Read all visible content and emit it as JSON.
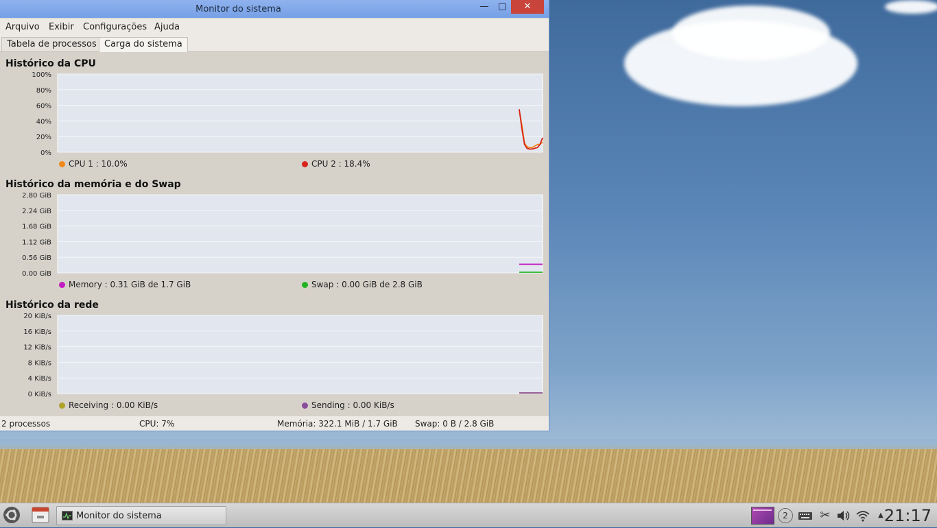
{
  "window": {
    "title": "Monitor do sistema",
    "controls": {
      "minimize": "—",
      "maximize": "□",
      "close": "✕"
    }
  },
  "menu": [
    "Arquivo",
    "Exibir",
    "Configurações",
    "Ajuda"
  ],
  "tabs": [
    {
      "label": "Tabela de processos",
      "active": false
    },
    {
      "label": "Carga do sistema",
      "active": true
    }
  ],
  "cpu": {
    "title": "Histórico da CPU",
    "ticks": [
      "100%",
      "80%",
      "60%",
      "40%",
      "20%",
      "0%"
    ],
    "legend": [
      {
        "label": "CPU 1 : 10.0%",
        "color": "#f08a1c"
      },
      {
        "label": "CPU 2 : 18.4%",
        "color": "#d8241a"
      }
    ]
  },
  "memory": {
    "title": "Histórico da memória e do Swap",
    "ticks": [
      "2.80 GiB",
      "2.24 GiB",
      "1.68 GiB",
      "1.12 GiB",
      "0.56 GiB",
      "0.00 GiB"
    ],
    "legend": [
      {
        "label": "Memory : 0.31 GiB de 1.7 GiB",
        "color": "#c21dc0"
      },
      {
        "label": "Swap : 0.00 GiB de 2.8 GiB",
        "color": "#22b322"
      }
    ]
  },
  "network": {
    "title": "Histórico da rede",
    "ticks": [
      "20 KiB/s",
      "16 KiB/s",
      "12 KiB/s",
      "8 KiB/s",
      "4 KiB/s",
      "0 KiB/s"
    ],
    "legend": [
      {
        "label": "Receiving : 0.00 KiB/s",
        "color": "#b0a22a"
      },
      {
        "label": "Sending : 0.00 KiB/s",
        "color": "#8a4c9c"
      }
    ]
  },
  "chart_data": [
    {
      "type": "line",
      "title": "Histórico da CPU",
      "ylim": [
        0,
        100
      ],
      "series": [
        {
          "name": "CPU 1",
          "values": [
            53,
            35,
            12,
            7,
            6,
            6,
            8,
            10,
            10,
            13
          ]
        },
        {
          "name": "CPU 2",
          "values": [
            55,
            30,
            10,
            5,
            4,
            4,
            5,
            6,
            10,
            18.4
          ]
        }
      ]
    },
    {
      "type": "line",
      "title": "Histórico da memória e do Swap",
      "ylim": [
        0,
        2.8
      ],
      "series": [
        {
          "name": "Memory",
          "values": [
            0.31,
            0.31,
            0.31,
            0.31,
            0.31,
            0.31,
            0.31,
            0.31,
            0.31,
            0.31
          ]
        },
        {
          "name": "Swap",
          "values": [
            0.0,
            0.0,
            0.0,
            0.0,
            0.0,
            0.0,
            0.0,
            0.0,
            0.0,
            0.0
          ]
        }
      ]
    },
    {
      "type": "line",
      "title": "Histórico da rede",
      "ylim": [
        0,
        20
      ],
      "series": [
        {
          "name": "Receiving",
          "values": [
            0,
            0,
            0,
            0,
            0,
            0,
            0,
            0,
            0,
            0
          ]
        },
        {
          "name": "Sending",
          "values": [
            0,
            0,
            0,
            0,
            0,
            0,
            0,
            0,
            0,
            0
          ]
        }
      ]
    }
  ],
  "status": {
    "processes": "2 processos",
    "cpu": "CPU: 7%",
    "memory": "Memória: 322.1 MiB / 1.7 GiB",
    "swap": "Swap: 0 B / 2.8 GiB"
  },
  "taskbar": {
    "task_label": "Monitor do sistema",
    "clock": "21:17",
    "workspace": "2",
    "icons": [
      "ubuntu-logo-icon",
      "file-manager-icon",
      "system-monitor-icon",
      "workspace-switcher-icon",
      "keyboard-icon",
      "scissors-icon",
      "volume-icon",
      "wifi-icon",
      "tray-arrow-icon"
    ]
  }
}
